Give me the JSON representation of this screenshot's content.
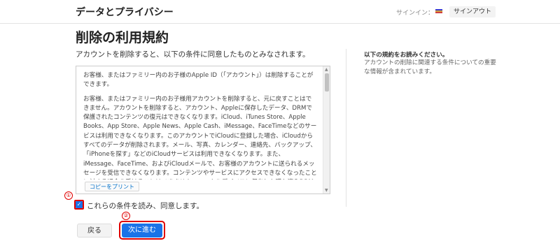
{
  "header": {
    "title": "データとプライバシー",
    "signin_label": "サインイン：",
    "signout_label": "サインアウト",
    "flag_icon": "flag-icon"
  },
  "main": {
    "title": "削除の利用規約",
    "intro": "アカウントを削除すると、以下の条件に同意したものとみなされます。",
    "terms": {
      "paragraphs": [
        "お客様、またはファミリー内のお子様のApple ID（「アカウント」）は削除することができます。",
        "お客様、またはファミリー内のお子様用アカウントを削除すると、元に戻すことはできません。アカウントを削除すると、アカウント、Appleに保存したデータ、DRMで保護されたコンテンツの復元はできなくなります。iCloud、iTunes Store、Apple Books、App Store、Apple News、Apple Cash、iMessage、FaceTimeなどのサービスは利用できなくなります。このアカウントでiCloudに登録した場合、iCloudからすべてのデータが削除されます。メール、写真、カレンダー、連絡先、バックアップ、「iPhoneを探す」などのiCloudサービスは利用できなくなります。また、iMessage、FaceTime、およびiCloudメールで、お客様のアカウントに送られるメッセージを受信できなくなります。コンテンツやサービスにアクセスできなくなったことに対する返金を受けることはできません。ローカルデバイスに保存した購入済みDRMフリーのコンテンツにはアクセ"
      ],
      "print_label": "コピーをプリント"
    },
    "checkbox_label": "これらの条件を読み、同意します。",
    "checkbox_checked": true,
    "back_label": "戻る",
    "next_label": "次に進む"
  },
  "sidebar": {
    "title": "以下の規約をお読みください。",
    "text": "アカウントの削除に関連する条件についての重要な情報が含まれています。"
  },
  "annotations": {
    "marker_1": "①",
    "marker_2": "②"
  },
  "colors": {
    "accent": "#1a73e8",
    "annotation": "#e00000"
  }
}
